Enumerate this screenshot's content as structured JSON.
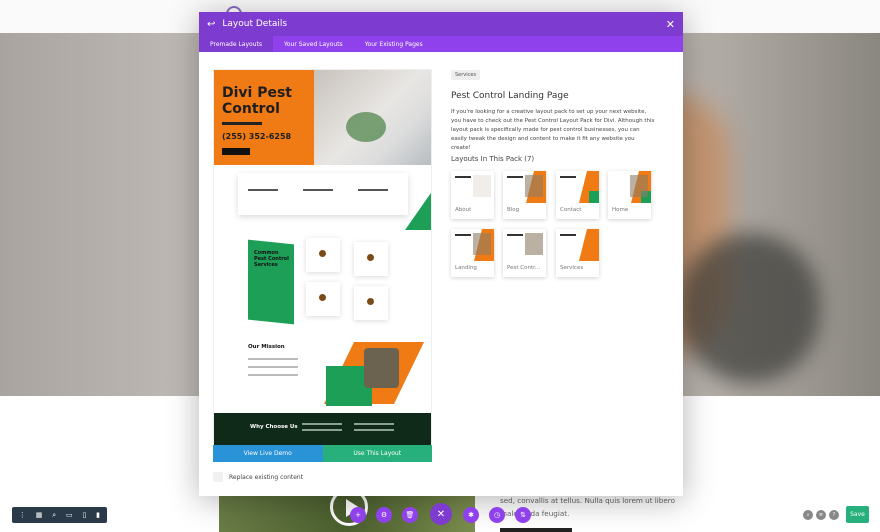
{
  "background": {
    "paragraph": "sed, convallis at tellus. Nulla quis lorem ut libero malesuada feugiat."
  },
  "modal": {
    "title": "Layout Details",
    "tabs": [
      {
        "label": "Premade Layouts",
        "active": true
      },
      {
        "label": "Your Saved Layouts",
        "active": false
      },
      {
        "label": "Your Existing Pages",
        "active": false
      }
    ],
    "preview": {
      "hero_title": "Divi Pest Control",
      "hero_phone": "(255) 352-6258",
      "section_title": "Common Pest Control Services",
      "mission_title": "Our Mission",
      "why_title": "Why Choose Us"
    },
    "buttons": {
      "view_demo": "View Live Demo",
      "use_layout": "Use This Layout"
    },
    "replace_label": "Replace existing content",
    "category_badge": "Services",
    "pack_title": "Pest Control Landing Page",
    "description": "If you're looking for a creative layout pack to set up your next website, you have to check out the Pest Control Layout Pack for Divi. Although this layout pack is specifically made for pest control businesses, you can easily tweak the design and content to make it fit any website you create!",
    "layouts_heading": "Layouts In This Pack (7)",
    "layouts": [
      "About",
      "Blog",
      "Contact",
      "Home",
      "Landing",
      "Pest Contr...",
      "Services"
    ]
  },
  "toolbar": {
    "save_label": "Save"
  },
  "colors": {
    "purple": "#7e3bd0",
    "purple_light": "#8f42ec",
    "orange": "#f07a13",
    "green": "#1e9f58",
    "blue": "#2a92d6",
    "teal": "#27b07b"
  }
}
